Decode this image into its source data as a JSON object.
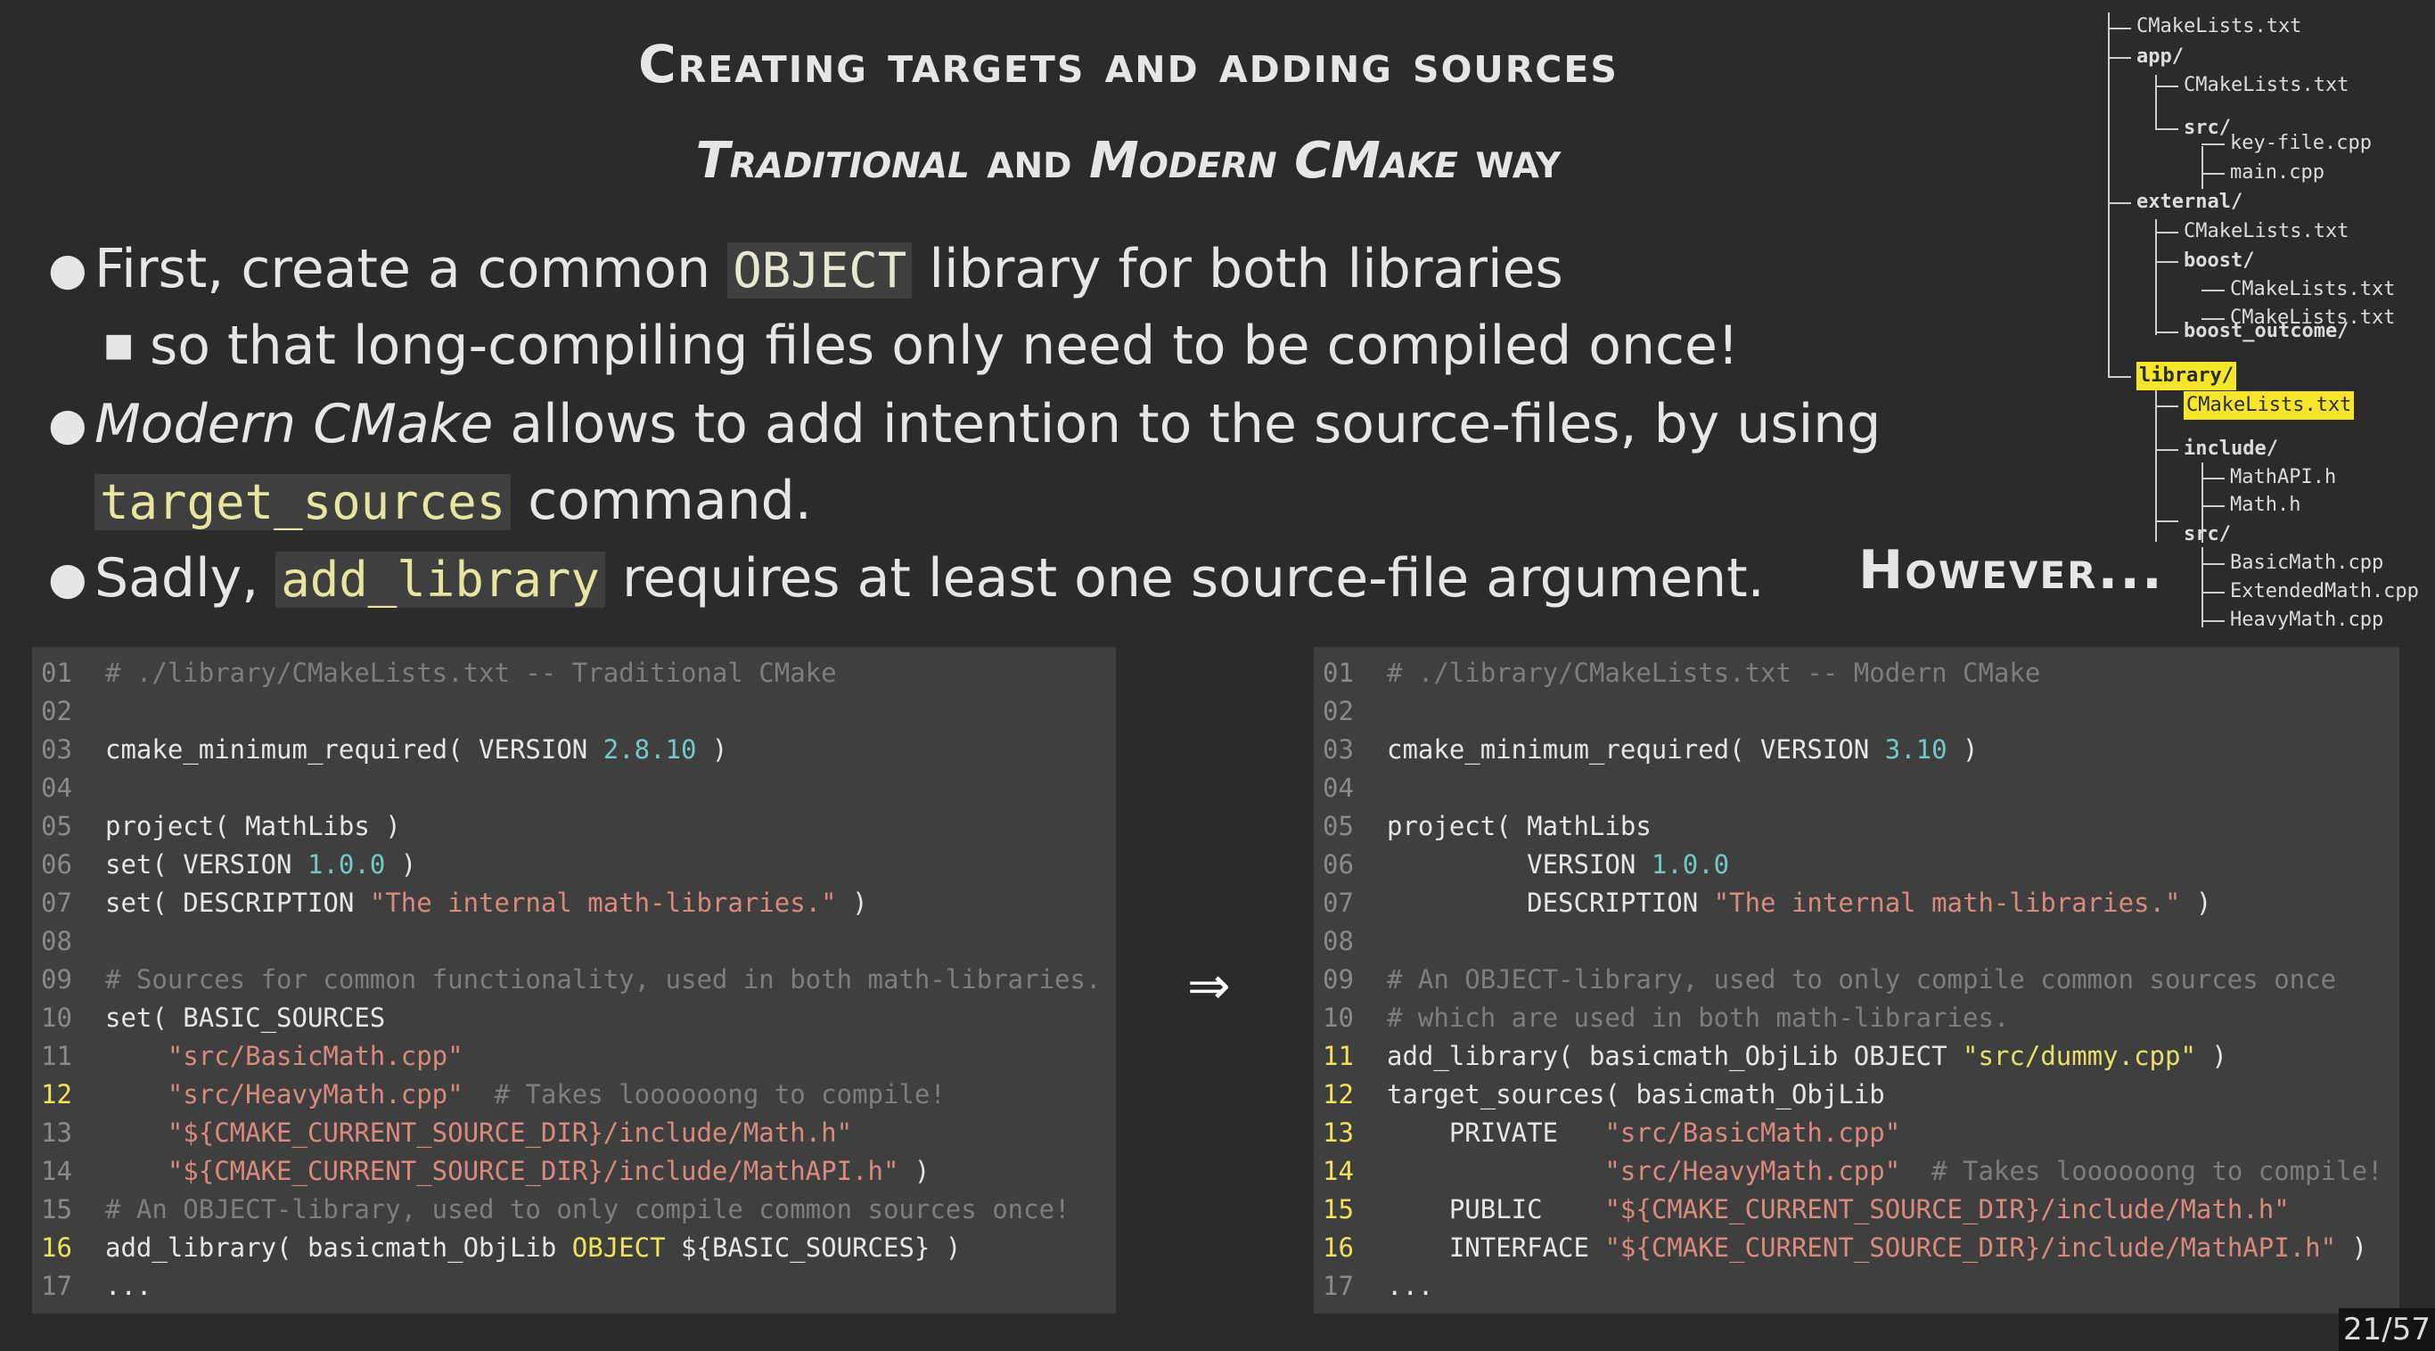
{
  "slide": {
    "title": "Creating targets and adding sources",
    "subtitle_parts": [
      "Traditional",
      " and ",
      "Modern CMake",
      " way"
    ],
    "bullets": {
      "b1_pre": "First, create a common ",
      "b1_code": "OBJECT",
      "b1_post": " library for both libraries",
      "b1_sub": "so that long-compiling files only need to be compiled once!",
      "b2_em": "Modern CMake",
      "b2_post": " allows to add intention to the source-files, by using",
      "b2_code": "target_sources",
      "b2_post2": " command.",
      "b3_pre": "Sadly, ",
      "b3_code": "add_library",
      "b3_post": " requires at least one source-file argument."
    },
    "however": "However...",
    "arrow": "⇒",
    "page": "21/57"
  },
  "tree": [
    "CMakeLists.txt",
    "app/",
    "CMakeLists.txt",
    "src/",
    "key-file.cpp",
    "main.cpp",
    "external/",
    "CMakeLists.txt",
    "boost/",
    "CMakeLists.txt",
    "boost_outcome/",
    "CMakeLists.txt",
    "library/",
    "CMakeLists.txt",
    "include/",
    "MathAPI.h",
    "Math.h",
    "src/",
    "BasicMath.cpp",
    "ExtendedMath.cpp",
    "HeavyMath.cpp"
  ],
  "code_left": {
    "nums": [
      "01",
      "02",
      "03",
      "04",
      "05",
      "06",
      "07",
      "08",
      "09",
      "10",
      "11",
      "12",
      "13",
      "14",
      "15",
      "16",
      "17"
    ],
    "l01": "# ./library/CMakeLists.txt -- Traditional CMake",
    "l03a": "cmake_minimum_required( VERSION ",
    "l03b": "2.8.10",
    "l03c": " )",
    "l05": "project( MathLibs )",
    "l06a": "set( VERSION ",
    "l06b": "1.0.0",
    "l06c": " )",
    "l07a": "set( DESCRIPTION ",
    "l07b": "\"The internal math-libraries.\"",
    "l07c": " )",
    "l09": "# Sources for common functionality, used in both math-libraries.",
    "l10": "set( BASIC_SOURCES",
    "l11": "    \"src/BasicMath.cpp\"",
    "l12a": "    \"src/HeavyMath.cpp\"",
    "l12b": "  # Takes loooooong to compile!",
    "l13": "    \"${CMAKE_CURRENT_SOURCE_DIR}/include/Math.h\"",
    "l14a": "    \"${CMAKE_CURRENT_SOURCE_DIR}/include/MathAPI.h\"",
    "l14b": " )",
    "l15": "# An OBJECT-library, used to only compile common sources once!",
    "l16a": "add_library( basicmath_ObjLib ",
    "l16b": "OBJECT",
    "l16c": " ${BASIC_SOURCES} )",
    "l17": "..."
  },
  "code_right": {
    "nums": [
      "01",
      "02",
      "03",
      "04",
      "05",
      "06",
      "07",
      "08",
      "09",
      "10",
      "11",
      "12",
      "13",
      "14",
      "15",
      "16",
      "17"
    ],
    "l01": "# ./library/CMakeLists.txt -- Modern CMake",
    "l03a": "cmake_minimum_required( VERSION ",
    "l03b": "3.10",
    "l03c": " )",
    "l05": "project( MathLibs",
    "l06a": "         VERSION ",
    "l06b": "1.0.0",
    "l07a": "         DESCRIPTION ",
    "l07b": "\"The internal math-libraries.\"",
    "l07c": " )",
    "l09": "# An OBJECT-library, used to only compile common sources once",
    "l10": "# which are used in both math-libraries.",
    "l11a": "add_library( basicmath_ObjLib OBJECT ",
    "l11b": "\"src/dummy.cpp\"",
    "l11c": " )",
    "l12": "target_sources( basicmath_ObjLib",
    "l13a": "    PRIVATE   ",
    "l13b": "\"src/BasicMath.cpp\"",
    "l14a": "              \"src/HeavyMath.cpp\"",
    "l14b": "  # Takes loooooong to compile!",
    "l15a": "    PUBLIC    ",
    "l15b": "\"${CMAKE_CURRENT_SOURCE_DIR}/include/Math.h\"",
    "l16a": "    INTERFACE ",
    "l16b": "\"${CMAKE_CURRENT_SOURCE_DIR}/include/MathAPI.h\"",
    "l16c": " )",
    "l17": "..."
  }
}
